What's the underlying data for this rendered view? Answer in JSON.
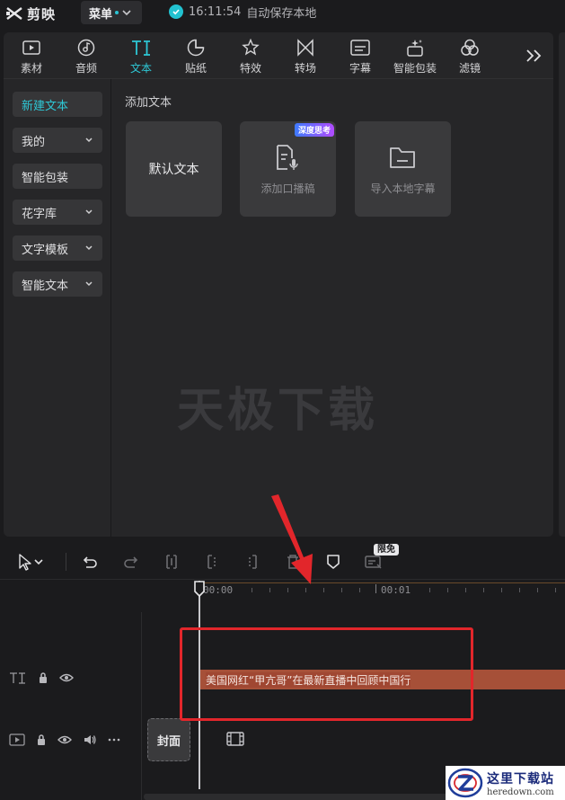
{
  "app": {
    "name": "剪映",
    "menu_label": "菜单",
    "save_time": "16:11:54",
    "save_text": "自动保存本地"
  },
  "toolbar": {
    "tools": [
      {
        "label": "素材",
        "icon": "media-icon"
      },
      {
        "label": "音频",
        "icon": "audio-icon"
      },
      {
        "label": "文本",
        "icon": "text-icon",
        "active": true
      },
      {
        "label": "贴纸",
        "icon": "sticker-icon"
      },
      {
        "label": "特效",
        "icon": "effects-icon"
      },
      {
        "label": "转场",
        "icon": "transition-icon"
      },
      {
        "label": "字幕",
        "icon": "subtitle-icon"
      },
      {
        "label": "智能包装",
        "icon": "smart-package-icon"
      },
      {
        "label": "滤镜",
        "icon": "filter-icon"
      }
    ],
    "more_icon": "double-chevron-right-icon"
  },
  "sidebar": {
    "items": [
      {
        "label": "新建文本",
        "active": true,
        "dropdown": false
      },
      {
        "label": "我的",
        "dropdown": true
      },
      {
        "label": "智能包装",
        "dropdown": false
      },
      {
        "label": "花字库",
        "dropdown": true
      },
      {
        "label": "文字模板",
        "dropdown": true
      },
      {
        "label": "智能文本",
        "dropdown": true
      }
    ]
  },
  "content": {
    "section_title": "添加文本",
    "cards": [
      {
        "label": "默认文本"
      },
      {
        "label": "添加口播稿",
        "badge": "深度思考",
        "icon": "script-mic-icon"
      },
      {
        "label": "导入本地字幕",
        "icon": "folder-icon"
      }
    ],
    "watermark": "天极下载"
  },
  "timeline": {
    "limit_badge": "限免",
    "ruler": {
      "start": "00:00",
      "mark": "00:01"
    },
    "text_clip": "美国网红“甲亢哥”在最新直播中回顾中国行",
    "cover_label": "封面"
  },
  "site_logo": {
    "name": "这里下载站",
    "url": "heredown.com"
  },
  "colors": {
    "accent": "#2ec8d6",
    "text_clip": "#a65038",
    "annotation_red": "#e2262b"
  }
}
